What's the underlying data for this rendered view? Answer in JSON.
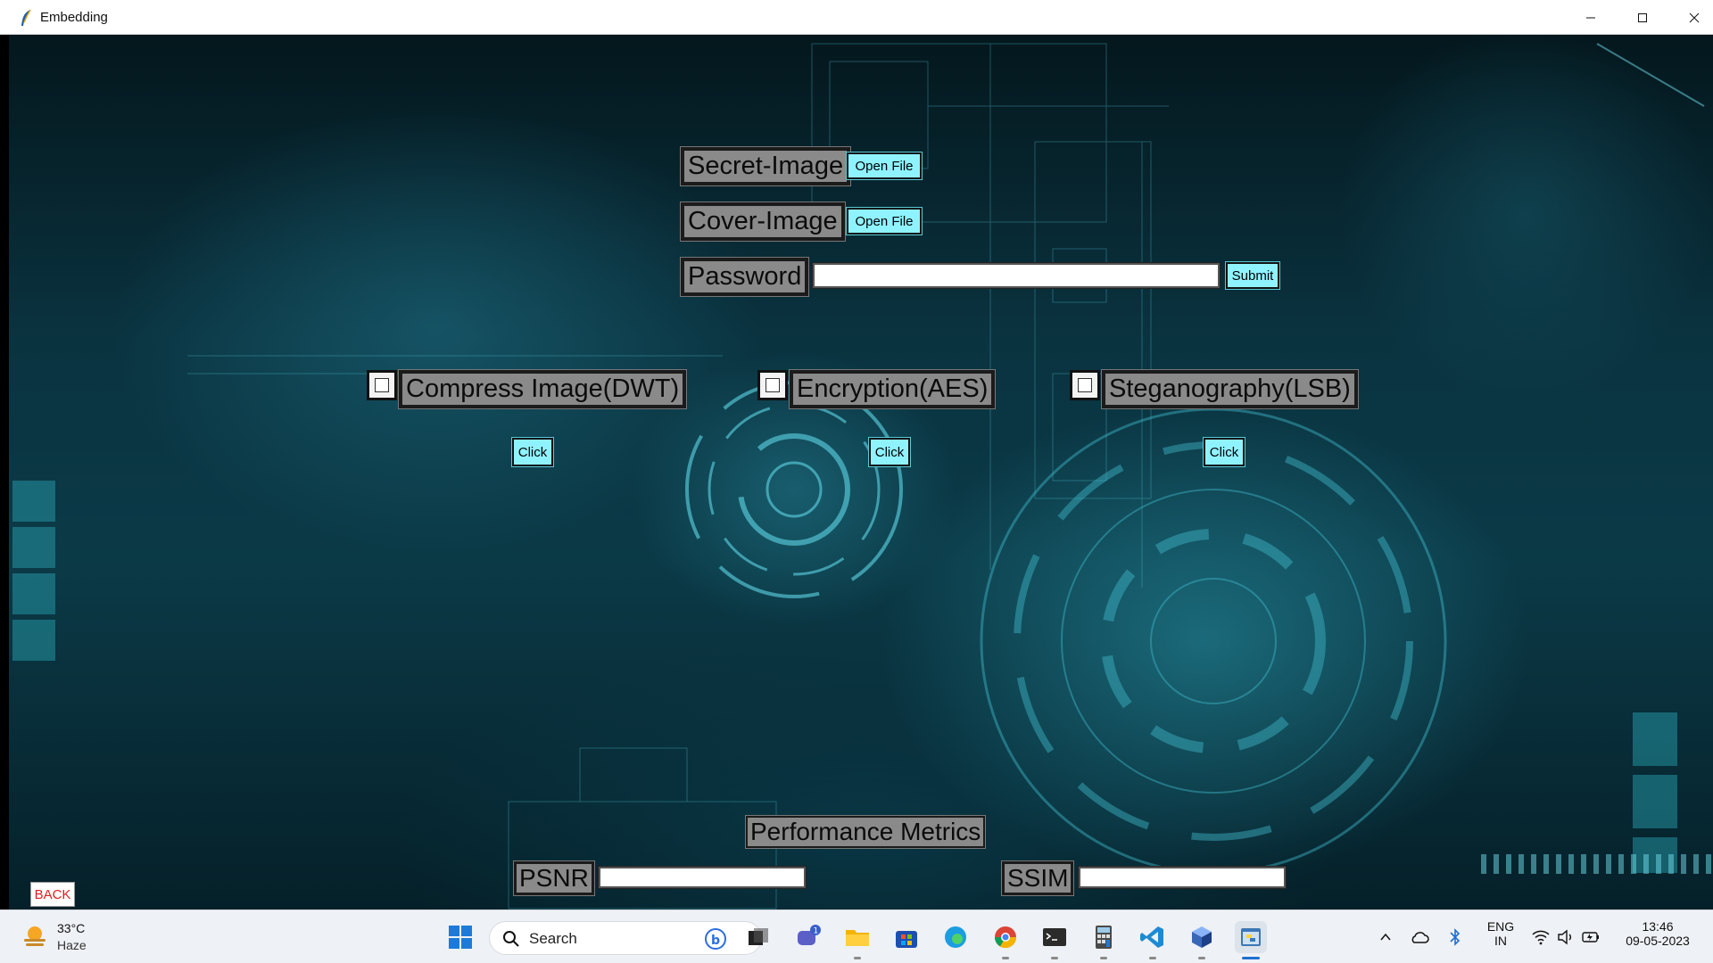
{
  "window": {
    "title": "Embedding"
  },
  "form": {
    "secret_label": "Secret-Image",
    "secret_button": "Open File",
    "cover_label": "Cover-Image",
    "cover_button": "Open File",
    "password_label": "Password",
    "password_value": "",
    "submit_button": "Submit",
    "options": [
      {
        "label": "Compress Image(DWT)",
        "checked": false,
        "button": "Click"
      },
      {
        "label": "Encryption(AES)",
        "checked": false,
        "button": "Click"
      },
      {
        "label": "Steganography(LSB)",
        "checked": false,
        "button": "Click"
      }
    ],
    "metrics_title": "Performance Metrics",
    "psnr_label": "PSNR",
    "psnr_value": "",
    "ssim_label": "SSIM",
    "ssim_value": "",
    "back_button": "BACK"
  },
  "colors": {
    "button_bg": "#8ff3ff",
    "label_bg": "#8a8a8a",
    "back_text": "#e02020"
  },
  "taskbar": {
    "weather": {
      "temp": "33°C",
      "condition": "Haze",
      "icon": "sun-haze-icon"
    },
    "search_placeholder": "Search",
    "pinned": [
      {
        "name": "start-icon"
      },
      {
        "name": "search-icon"
      },
      {
        "name": "bing-icon"
      },
      {
        "name": "task-view-icon"
      },
      {
        "name": "teams-chat-icon",
        "badge": "1"
      },
      {
        "name": "file-explorer-icon"
      },
      {
        "name": "microsoft-store-icon"
      },
      {
        "name": "edge-icon"
      },
      {
        "name": "chrome-icon"
      },
      {
        "name": "terminal-icon"
      },
      {
        "name": "calculator-icon"
      },
      {
        "name": "vscode-icon"
      },
      {
        "name": "3d-box-icon"
      },
      {
        "name": "python-icon"
      }
    ],
    "tray": {
      "language_line1": "ENG",
      "language_line2": "IN",
      "time": "13:46",
      "date": "09-05-2023"
    }
  }
}
